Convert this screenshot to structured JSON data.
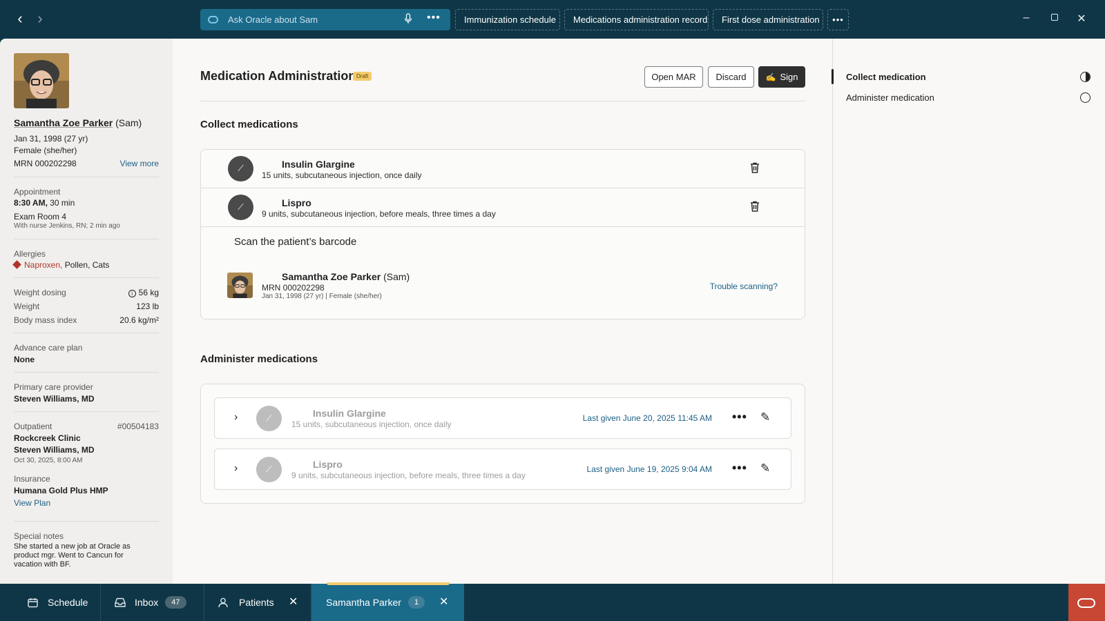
{
  "topbar": {
    "ask_placeholder": "Ask Oracle about Sam",
    "chips": [
      "Immunization schedule",
      "Medications administration record",
      "First dose administration"
    ],
    "more_label": "•••"
  },
  "patient": {
    "name": "Samantha Zoe Parker",
    "nickname": "(Sam)",
    "dob": "Jan 31, 1998 (27 yr)",
    "sex": "Female (she/her)",
    "mrn": "MRN 000202298",
    "view_more": "View more",
    "appointment_label": "Appointment",
    "appointment_time": "8:30 AM,",
    "appointment_duration": "30 min",
    "room": "Exam Room 4",
    "room_note": "With nurse Jenkins, RN; 2 min ago",
    "allergies_label": "Allergies",
    "allergy_severe": "Naproxen,",
    "allergies_other": "Pollen, Cats",
    "weight_dosing_label": "Weight dosing",
    "weight_dosing_value": "56 kg",
    "weight_label": "Weight",
    "weight_value": "123 lb",
    "bmi_label": "Body mass index",
    "bmi_value": "20.6 kg/m²",
    "acp_label": "Advance care plan",
    "acp_value": "None",
    "pcp_label": "Primary care provider",
    "pcp_value": "Steven Williams, MD",
    "outpatient_label": "Outpatient",
    "outpatient_id": "#00504183",
    "clinic": "Rockcreek Clinic",
    "clinic_provider": "Steven Williams, MD",
    "clinic_date": "Oct 30, 2025, 8:00 AM",
    "insurance_label": "Insurance",
    "insurance_value": "Humana Gold Plus HMP",
    "view_plan": "View Plan",
    "notes_label": "Special notes",
    "notes_value": "She started a new job at Oracle as product mgr. Went to Cancun for vacation with BF."
  },
  "header": {
    "title": "Medication Administration",
    "status_badge": "Draft",
    "open_mar": "Open MAR",
    "discard": "Discard",
    "sign": "Sign"
  },
  "collect": {
    "heading": "Collect medications",
    "meds": [
      {
        "name": "Insulin Glargine",
        "desc": "15 units, subcutaneous injection, once daily"
      },
      {
        "name": "Lispro",
        "desc": "9 units, subcutaneous injection, before meals, three times a day"
      }
    ],
    "scan_title": "Scan the patient’s barcode",
    "scan_name": "Samantha Zoe Parker",
    "scan_nick": "(Sam)",
    "scan_mrn": "MRN 000202298",
    "scan_info": "Jan 31, 1998 (27 yr) | Female (she/her)",
    "trouble": "Trouble scanning?"
  },
  "administer": {
    "heading": "Administer medications",
    "meds": [
      {
        "name": "Insulin Glargine",
        "desc": "15 units, subcutaneous injection, once daily",
        "last_given": "Last given June 20, 2025 11:45 AM"
      },
      {
        "name": "Lispro",
        "desc": "9 units, subcutaneous injection, before meals, three times a day",
        "last_given": "Last given June 19, 2025 9:04 AM"
      }
    ]
  },
  "steps": [
    {
      "label": "Collect medication",
      "state": "in-progress"
    },
    {
      "label": "Administer medication",
      "state": "not-started"
    }
  ],
  "taskbar": {
    "schedule": "Schedule",
    "inbox": "Inbox",
    "inbox_count": "47",
    "patients": "Patients",
    "active_patient": "Samantha Parker",
    "active_count": "1"
  },
  "colors": {
    "topbar": "#0f3646",
    "accent": "#1a6a8a",
    "link": "#1b5f85",
    "allergy": "#b1352a",
    "draft": "#f4cb6c",
    "oracle": "#c74634"
  }
}
